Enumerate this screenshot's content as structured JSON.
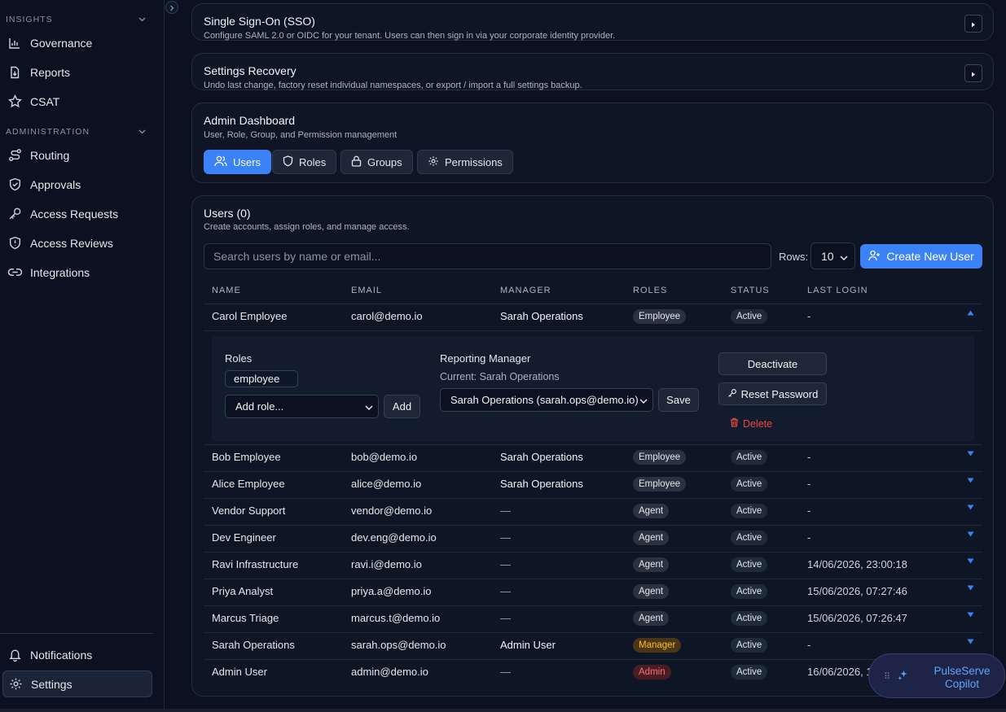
{
  "sidebar": {
    "sections": [
      {
        "title": "INSIGHTS",
        "items": [
          "Governance",
          "Reports",
          "CSAT"
        ]
      },
      {
        "title": "ADMINISTRATION",
        "items": [
          "Routing",
          "Approvals",
          "Access Requests",
          "Access Reviews",
          "Integrations"
        ]
      }
    ],
    "footer_items": [
      "Notifications",
      "Settings"
    ],
    "active_item": "Settings"
  },
  "sso": {
    "title": "Single Sign-On (SSO)",
    "subtitle": "Configure SAML 2.0 or OIDC for your tenant. Users can then sign in via your corporate identity provider."
  },
  "recovery": {
    "title": "Settings Recovery",
    "subtitle": "Undo last change, factory reset individual namespaces, or export / import a full settings backup."
  },
  "admin": {
    "title": "Admin Dashboard",
    "subtitle": "User, Role, Group, and Permission management",
    "tabs": [
      "Users",
      "Roles",
      "Groups",
      "Permissions"
    ],
    "active_tab": "Users"
  },
  "users": {
    "title": "Users (0)",
    "subtitle": "Create accounts, assign roles, and manage access.",
    "search_placeholder": "Search users by name or email...",
    "rows_label": "Rows:",
    "rows_value": "10",
    "create_label": "Create New User",
    "columns": [
      "NAME",
      "EMAIL",
      "MANAGER",
      "ROLES",
      "STATUS",
      "LAST LOGIN"
    ],
    "rows": [
      {
        "name": "Carol Employee",
        "email": "carol@demo.io",
        "manager": "Sarah Operations",
        "role": "Employee",
        "status": "Active",
        "last_login": "-"
      },
      {
        "name": "Bob Employee",
        "email": "bob@demo.io",
        "manager": "Sarah Operations",
        "role": "Employee",
        "status": "Active",
        "last_login": "-"
      },
      {
        "name": "Alice Employee",
        "email": "alice@demo.io",
        "manager": "Sarah Operations",
        "role": "Employee",
        "status": "Active",
        "last_login": "-"
      },
      {
        "name": "Vendor Support",
        "email": "vendor@demo.io",
        "manager": "—",
        "role": "Agent",
        "status": "Active",
        "last_login": "-"
      },
      {
        "name": "Dev Engineer",
        "email": "dev.eng@demo.io",
        "manager": "—",
        "role": "Agent",
        "status": "Active",
        "last_login": "-"
      },
      {
        "name": "Ravi Infrastructure",
        "email": "ravi.i@demo.io",
        "manager": "—",
        "role": "Agent",
        "status": "Active",
        "last_login": "14/06/2026, 23:00:18"
      },
      {
        "name": "Priya Analyst",
        "email": "priya.a@demo.io",
        "manager": "—",
        "role": "Agent",
        "status": "Active",
        "last_login": "15/06/2026, 07:27:46"
      },
      {
        "name": "Marcus Triage",
        "email": "marcus.t@demo.io",
        "manager": "—",
        "role": "Agent",
        "status": "Active",
        "last_login": "15/06/2026, 07:26:47"
      },
      {
        "name": "Sarah Operations",
        "email": "sarah.ops@demo.io",
        "manager": "Admin User",
        "role": "Manager",
        "status": "Active",
        "last_login": "-"
      },
      {
        "name": "Admin User",
        "email": "admin@demo.io",
        "manager": "—",
        "role": "Admin",
        "status": "Active",
        "last_login": "16/06/2026, 1"
      }
    ],
    "expanded": {
      "roles_label": "Roles",
      "role_chip": "employee",
      "add_role_placeholder": "Add role...",
      "add_label": "Add",
      "manager_label": "Reporting Manager",
      "current_manager": "Current: Sarah Operations",
      "manager_select": "Sarah Operations (sarah.ops@demo.io)",
      "save_label": "Save",
      "deactivate_label": "Deactivate",
      "reset_label": "Reset Password",
      "delete_label": "Delete"
    }
  },
  "copilot": {
    "line1": "PulseServe",
    "line2": "Copilot"
  },
  "colors": {
    "accent": "#3b82f6",
    "manager_badge": "#fbbf24",
    "admin_badge": "#f87171",
    "delete": "#ef4444"
  }
}
